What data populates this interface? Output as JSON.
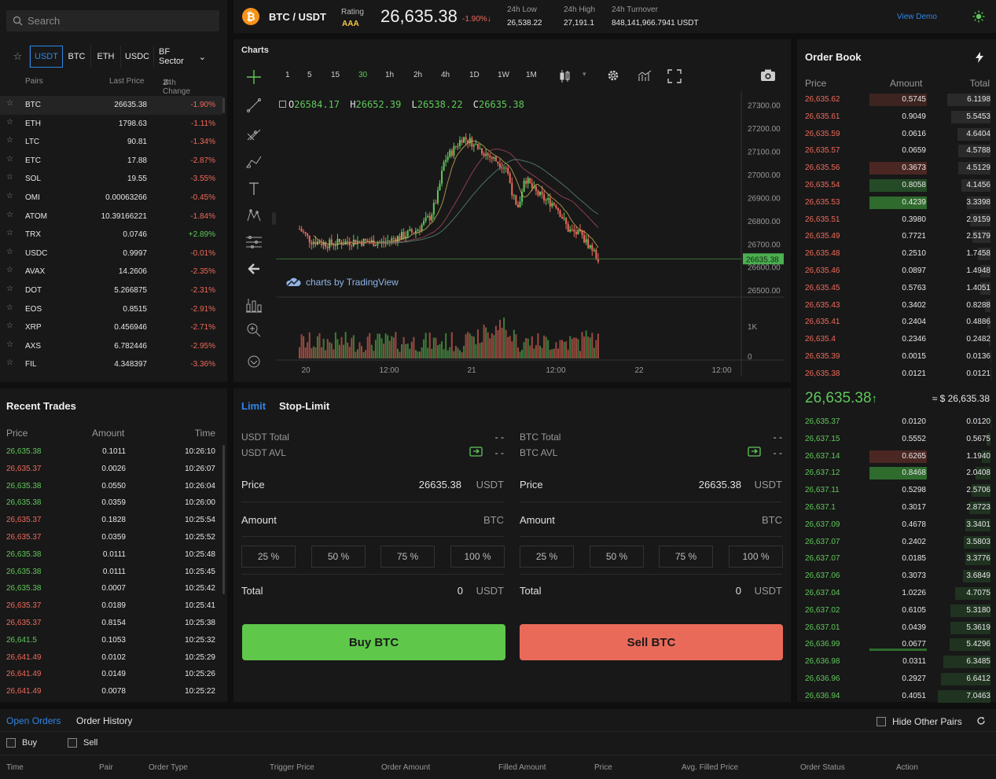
{
  "search": {
    "placeholder": "Search"
  },
  "quote_tabs": [
    "USDT",
    "BTC",
    "ETH",
    "USDC",
    "BF Sector"
  ],
  "pair_headers": {
    "pairs": "Pairs",
    "last_price": "Last Price",
    "change": "24h Change"
  },
  "pairs": [
    {
      "name": "BTC",
      "price": "26635.38",
      "change": "-1.90%",
      "dir": "down"
    },
    {
      "name": "ETH",
      "price": "1798.63",
      "change": "-1.11%",
      "dir": "down"
    },
    {
      "name": "LTC",
      "price": "90.81",
      "change": "-1.34%",
      "dir": "down"
    },
    {
      "name": "ETC",
      "price": "17.88",
      "change": "-2.87%",
      "dir": "down"
    },
    {
      "name": "SOL",
      "price": "19.55",
      "change": "-3.55%",
      "dir": "down"
    },
    {
      "name": "OMI",
      "price": "0.00063266",
      "change": "-0.45%",
      "dir": "down"
    },
    {
      "name": "ATOM",
      "price": "10.39166221",
      "change": "-1.84%",
      "dir": "down"
    },
    {
      "name": "TRX",
      "price": "0.0746",
      "change": "+2.89%",
      "dir": "up"
    },
    {
      "name": "USDC",
      "price": "0.9997",
      "change": "-0.01%",
      "dir": "down"
    },
    {
      "name": "AVAX",
      "price": "14.2606",
      "change": "-2.35%",
      "dir": "down"
    },
    {
      "name": "DOT",
      "price": "5.266875",
      "change": "-2.31%",
      "dir": "down"
    },
    {
      "name": "EOS",
      "price": "0.8515",
      "change": "-2.91%",
      "dir": "down"
    },
    {
      "name": "XRP",
      "price": "0.456946",
      "change": "-2.71%",
      "dir": "down"
    },
    {
      "name": "AXS",
      "price": "6.782446",
      "change": "-2.95%",
      "dir": "down"
    },
    {
      "name": "FIL",
      "price": "4.348397",
      "change": "-3.36%",
      "dir": "down"
    }
  ],
  "header": {
    "pair": "BTC / USDT",
    "rating_label": "Rating",
    "rating_value": "AAA",
    "price": "26,635.38",
    "change": "-1.90%",
    "low_label": "24h Low",
    "low": "26,538.22",
    "high_label": "24h High",
    "high": "27,191.1",
    "turnover_label": "24h Turnover",
    "turnover": "848,141,966.7941 USDT",
    "view_demo": "View Demo"
  },
  "chart": {
    "title": "Charts",
    "timeframes": [
      "1",
      "5",
      "15",
      "30",
      "1h",
      "2h",
      "4h",
      "1D",
      "1W",
      "1M"
    ],
    "active_timeframe": "30",
    "ohlc": {
      "o_label": "O",
      "o": "26584.17",
      "h_label": "H",
      "h": "26652.39",
      "l_label": "L",
      "l": "26538.22",
      "c_label": "C",
      "c": "26635.38"
    },
    "attribution": "charts by TradingView",
    "price_ticks": [
      "27300.00",
      "27200.00",
      "27100.00",
      "27000.00",
      "26900.00",
      "26800.00",
      "26700.00",
      "26600.00",
      "26500.00"
    ],
    "last_price_tag": "26635.38",
    "volume_ticks": [
      "1K",
      "0"
    ],
    "time_ticks": [
      "20",
      "12:00",
      "21",
      "12:00",
      "22",
      "12:00"
    ]
  },
  "chart_data": {
    "type": "candlestick",
    "x_ticks": [
      "20",
      "12:00",
      "21",
      "12:00",
      "22",
      "12:00"
    ],
    "ylim": [
      26500,
      27350
    ],
    "last_price": 26635.38,
    "open": 26584.17,
    "high": 26652.39,
    "low": 26538.22,
    "close": 26635.38
  },
  "order_book": {
    "title": "Order Book",
    "headers": {
      "price": "Price",
      "amount": "Amount",
      "total": "Total"
    },
    "asks": [
      {
        "price": "26,635.62",
        "amount": "0.5745",
        "total": "6.1198",
        "bar": 0.84
      },
      {
        "price": "26,635.61",
        "amount": "0.9049",
        "total": "5.5453",
        "bar": 0.0
      },
      {
        "price": "26,635.59",
        "amount": "0.0616",
        "total": "4.6404",
        "bar": 0.0
      },
      {
        "price": "26,635.57",
        "amount": "0.0659",
        "total": "4.5788",
        "bar": 0.0
      },
      {
        "price": "26,635.56",
        "amount": "0.3673",
        "total": "4.5129",
        "bar": 0.84
      },
      {
        "price": "26,635.54",
        "amount": "0.8058",
        "total": "4.1456",
        "bar": 0.0
      },
      {
        "price": "26,635.53",
        "amount": "0.4239",
        "total": "3.3398",
        "bar": 0.0
      },
      {
        "price": "26,635.51",
        "amount": "0.3980",
        "total": "2.9159",
        "bar": 0.0
      },
      {
        "price": "26,635.49",
        "amount": "0.7721",
        "total": "2.5179",
        "bar": 0.0
      },
      {
        "price": "26,635.48",
        "amount": "0.2510",
        "total": "1.7458",
        "bar": 0.0
      },
      {
        "price": "26,635.46",
        "amount": "0.0897",
        "total": "1.4948",
        "bar": 0.0
      },
      {
        "price": "26,635.45",
        "amount": "0.5763",
        "total": "1.4051",
        "bar": 0.0
      },
      {
        "price": "26,635.43",
        "amount": "0.3402",
        "total": "0.8288",
        "bar": 0.0
      },
      {
        "price": "26,635.41",
        "amount": "0.2404",
        "total": "0.4886",
        "bar": 0.0
      },
      {
        "price": "26,635.4",
        "amount": "0.2346",
        "total": "0.2482",
        "bar": 0.0
      },
      {
        "price": "26,635.39",
        "amount": "0.0015",
        "total": "0.0136",
        "bar": 0.0
      },
      {
        "price": "26,635.38",
        "amount": "0.0121",
        "total": "0.0121",
        "bar": 0.0
      }
    ],
    "mid_price": "26,635.38",
    "mid_usd": "≈ $ 26,635.38",
    "bids": [
      {
        "price": "26,635.37",
        "amount": "0.0120",
        "total": "0.0120"
      },
      {
        "price": "26,637.15",
        "amount": "0.5552",
        "total": "0.5675"
      },
      {
        "price": "26,637.14",
        "amount": "0.6265",
        "total": "1.1940"
      },
      {
        "price": "26,637.12",
        "amount": "0.8468",
        "total": "2.0408"
      },
      {
        "price": "26,637.11",
        "amount": "0.5298",
        "total": "2.5706"
      },
      {
        "price": "26,637.1",
        "amount": "0.3017",
        "total": "2.8723"
      },
      {
        "price": "26,637.09",
        "amount": "0.4678",
        "total": "3.3401"
      },
      {
        "price": "26,637.07",
        "amount": "0.2402",
        "total": "3.5803"
      },
      {
        "price": "26,637.07",
        "amount": "0.0185",
        "total": "3.3776"
      },
      {
        "price": "26,637.06",
        "amount": "0.3073",
        "total": "3.6849"
      },
      {
        "price": "26,637.04",
        "amount": "1.0226",
        "total": "4.7075"
      },
      {
        "price": "26,637.02",
        "amount": "0.6105",
        "total": "5.3180"
      },
      {
        "price": "26,637.01",
        "amount": "0.0439",
        "total": "5.3619"
      },
      {
        "price": "26,636.99",
        "amount": "0.0677",
        "total": "5.4296"
      },
      {
        "price": "26,636.98",
        "amount": "0.0311",
        "total": "6.3485"
      },
      {
        "price": "26,636.96",
        "amount": "0.2927",
        "total": "6.6412"
      },
      {
        "price": "26,636.94",
        "amount": "0.4051",
        "total": "7.0463"
      }
    ]
  },
  "recent_trades": {
    "title": "Recent Trades",
    "headers": {
      "price": "Price",
      "amount": "Amount",
      "time": "Time"
    },
    "rows": [
      {
        "price": "26,635.38",
        "amount": "0.1011",
        "time": "10:26:10",
        "dir": "up"
      },
      {
        "price": "26,635.37",
        "amount": "0.0026",
        "time": "10:26:07",
        "dir": "down"
      },
      {
        "price": "26,635.38",
        "amount": "0.0550",
        "time": "10:26:04",
        "dir": "up"
      },
      {
        "price": "26,635.38",
        "amount": "0.0359",
        "time": "10:26:00",
        "dir": "up"
      },
      {
        "price": "26,635.37",
        "amount": "0.1828",
        "time": "10:25:54",
        "dir": "down"
      },
      {
        "price": "26,635.37",
        "amount": "0.0359",
        "time": "10:25:52",
        "dir": "down"
      },
      {
        "price": "26,635.38",
        "amount": "0.0111",
        "time": "10:25:48",
        "dir": "up"
      },
      {
        "price": "26,635.38",
        "amount": "0.0111",
        "time": "10:25:45",
        "dir": "up"
      },
      {
        "price": "26,635.38",
        "amount": "0.0007",
        "time": "10:25:42",
        "dir": "up"
      },
      {
        "price": "26,635.37",
        "amount": "0.0189",
        "time": "10:25:41",
        "dir": "down"
      },
      {
        "price": "26,635.37",
        "amount": "0.8154",
        "time": "10:25:38",
        "dir": "down"
      },
      {
        "price": "26,641.5",
        "amount": "0.1053",
        "time": "10:25:32",
        "dir": "up"
      },
      {
        "price": "26,641.49",
        "amount": "0.0102",
        "time": "10:25:29",
        "dir": "down"
      },
      {
        "price": "26,641.49",
        "amount": "0.0149",
        "time": "10:25:26",
        "dir": "down"
      },
      {
        "price": "26,641.49",
        "amount": "0.0078",
        "time": "10:25:22",
        "dir": "down"
      }
    ]
  },
  "trade_form": {
    "tab_limit": "Limit",
    "tab_stop": "Stop-Limit",
    "buy": {
      "total_label": "USDT Total",
      "total_value": "- -",
      "avl_label": "USDT AVL",
      "avl_value": "- -",
      "price_label": "Price",
      "price_value": "26635.38",
      "price_unit": "USDT",
      "amount_label": "Amount",
      "amount_unit": "BTC",
      "pcts": [
        "25 %",
        "50 %",
        "75 %",
        "100 %"
      ],
      "sum_label": "Total",
      "sum_value": "0",
      "sum_unit": "USDT",
      "button": "Buy BTC"
    },
    "sell": {
      "total_label": "BTC Total",
      "total_value": "- -",
      "avl_label": "BTC AVL",
      "avl_value": "- -",
      "price_label": "Price",
      "price_value": "26635.38",
      "price_unit": "USDT",
      "amount_label": "Amount",
      "amount_unit": "BTC",
      "pcts": [
        "25 %",
        "50 %",
        "75 %",
        "100 %"
      ],
      "sum_label": "Total",
      "sum_value": "0",
      "sum_unit": "USDT",
      "button": "Sell BTC"
    }
  },
  "orders": {
    "tab_open": "Open Orders",
    "tab_history": "Order History",
    "hide_pairs": "Hide Other Pairs",
    "filter_buy": "Buy",
    "filter_sell": "Sell",
    "columns": [
      "Time",
      "Pair",
      "Order Type",
      "Trigger Price",
      "Order Amount",
      "Filled Amount",
      "Price",
      "Avg. Filled Price",
      "Order Status",
      "Action"
    ]
  },
  "colors": {
    "up": "#5fc85a",
    "down": "#ee6a5b",
    "accent": "#2f86e8",
    "btc": "#f7931a"
  }
}
